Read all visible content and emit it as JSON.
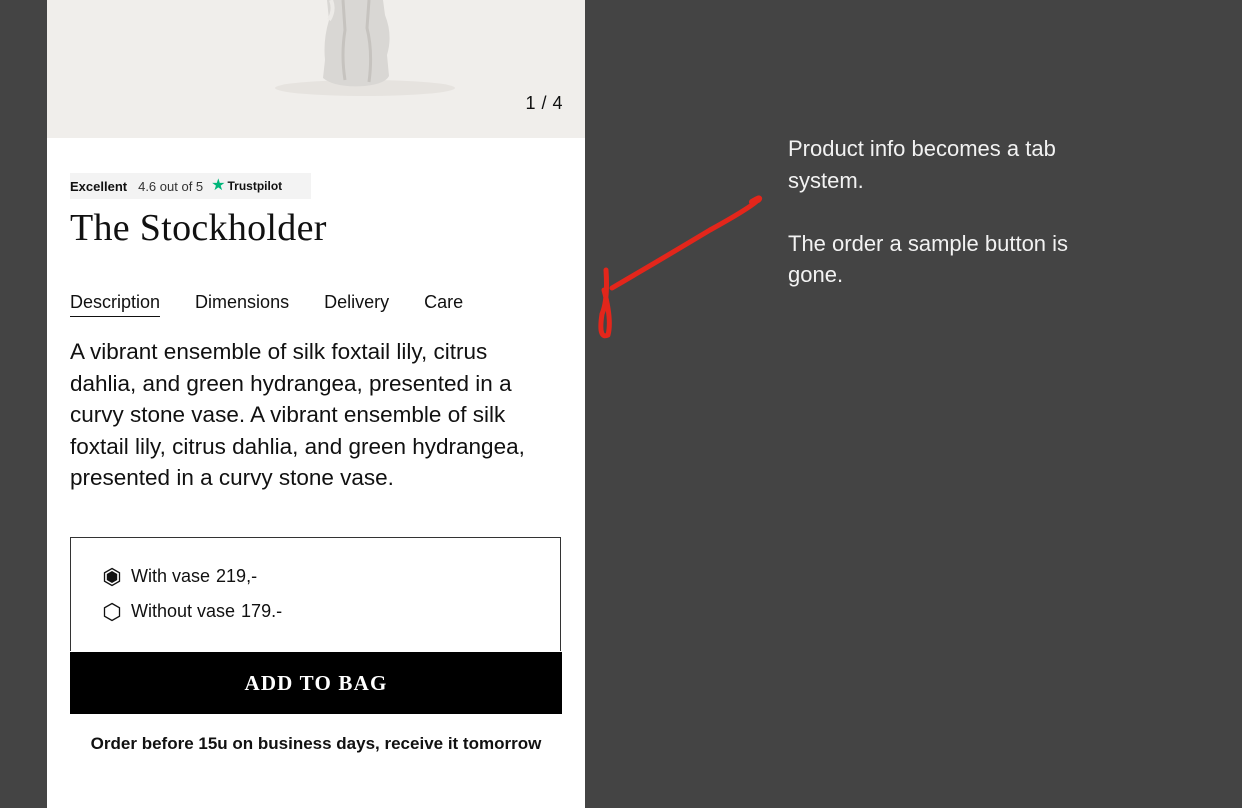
{
  "gallery": {
    "counter": "1 / 4"
  },
  "trustpilot": {
    "rating_word": "Excellent",
    "score": "4.6 out of 5",
    "brand": "Trustpilot",
    "star_color": "#00b67a"
  },
  "product": {
    "title": "The Stockholder",
    "tabs": [
      "Description",
      "Dimensions",
      "Delivery",
      "Care"
    ],
    "active_tab": "Description",
    "description": "A vibrant ensemble of silk foxtail lily, citrus dahlia, and green hydrangea, presented in a curvy stone vase. A vibrant ensemble of silk foxtail lily, citrus dahlia, and green hydrangea, presented in a curvy stone vase.",
    "options": [
      {
        "label": "With vase",
        "price": "219,-",
        "selected": true
      },
      {
        "label": "Without vase",
        "price": "179.-",
        "selected": false
      }
    ],
    "add_to_bag": "ADD TO BAG",
    "delivery_note": "Order before 15u on business days, receive it tomorrow"
  },
  "annotation": {
    "line1": "Product info becomes a tab system.",
    "line2": "The order a sample button is gone.",
    "arrow_color": "#e3261b"
  }
}
